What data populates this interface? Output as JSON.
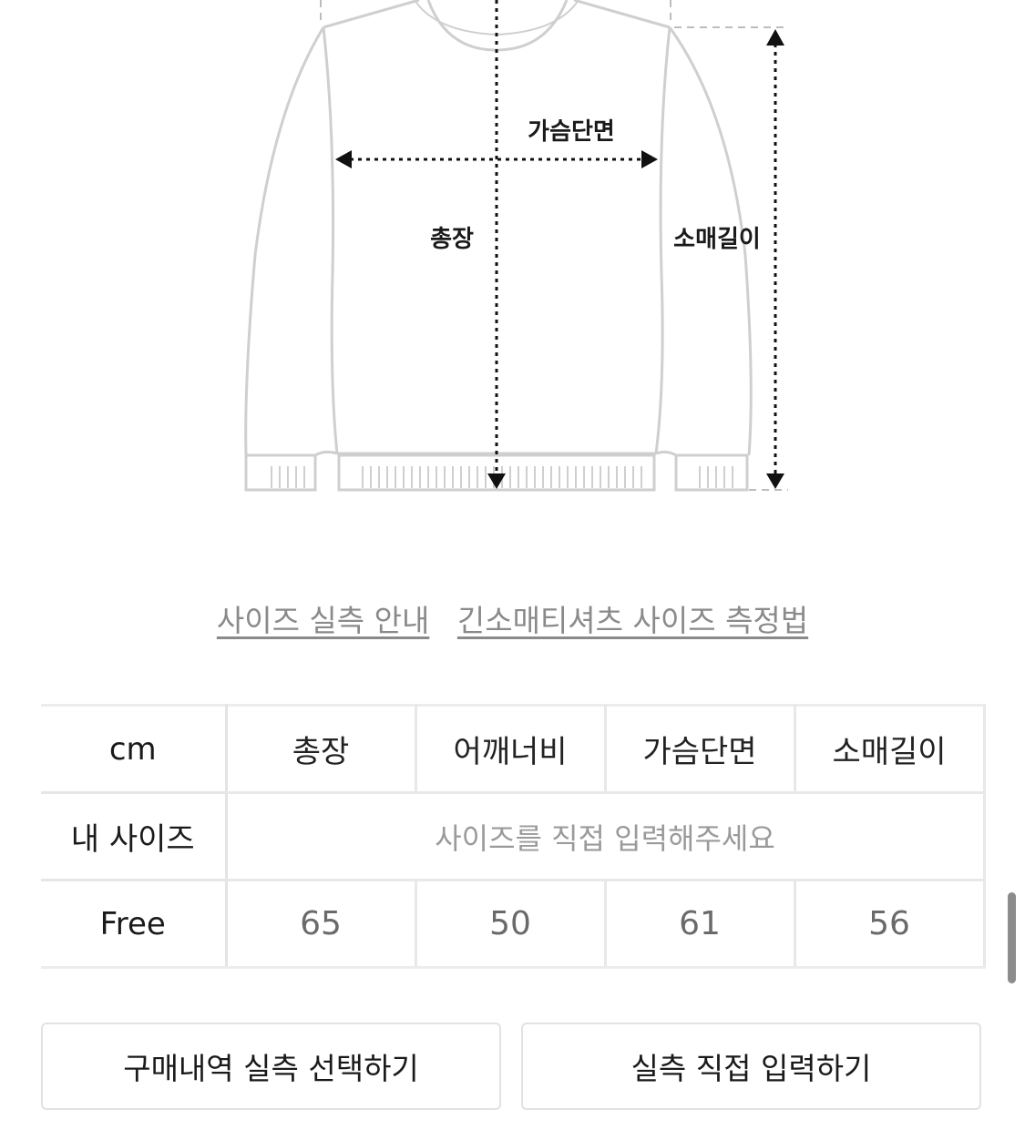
{
  "diagram": {
    "labels": {
      "chest": "가슴단면",
      "length": "총장",
      "sleeve": "소매길이"
    }
  },
  "links": {
    "size_guide": "사이즈 실측 안내",
    "measure_method": "긴소매티셔츠 사이즈 측정법"
  },
  "table": {
    "headers": [
      "cm",
      "총장",
      "어깨너비",
      "가슴단면",
      "소매길이"
    ],
    "my_size_label": "내 사이즈",
    "my_size_placeholder": "사이즈를 직접 입력해주세요",
    "rows": [
      {
        "size": "Free",
        "values": [
          "65",
          "50",
          "61",
          "56"
        ]
      }
    ]
  },
  "buttons": {
    "purchase_history": "구매내역 실측 선택하기",
    "direct_input": "실측 직접 입력하기"
  }
}
